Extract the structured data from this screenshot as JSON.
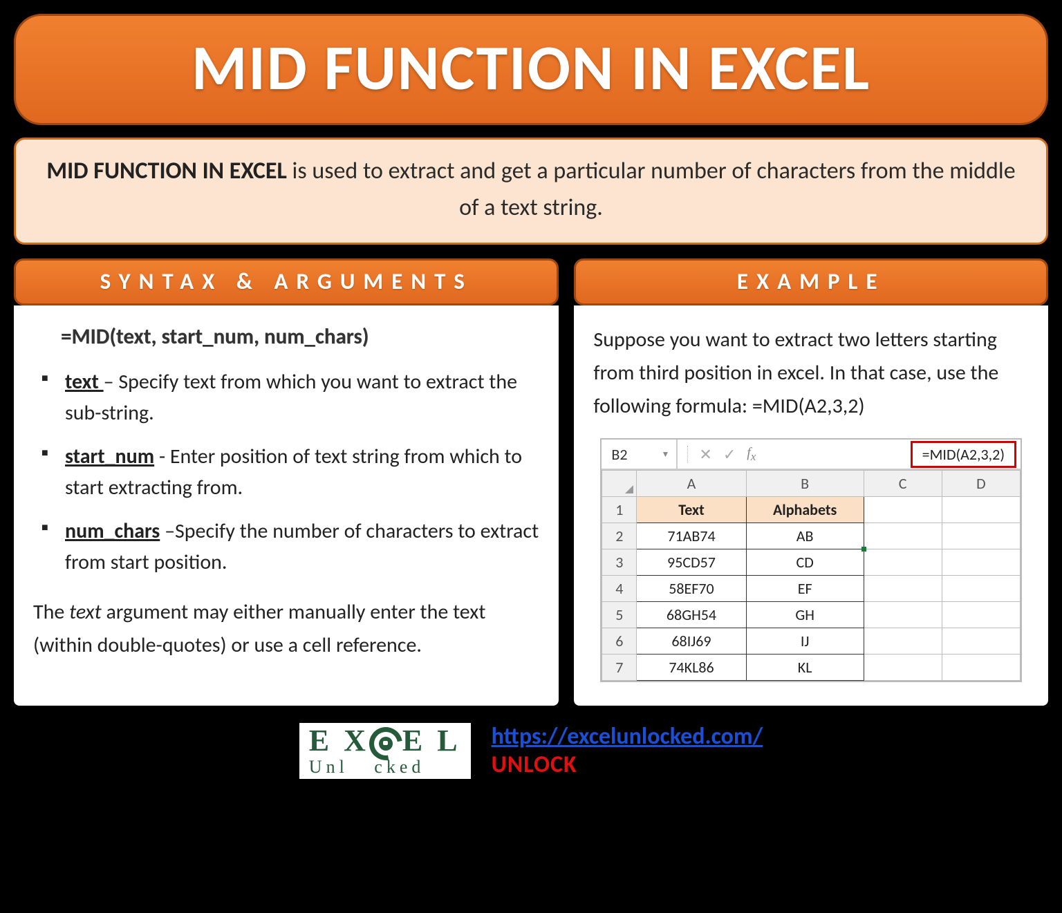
{
  "title": "MID FUNCTION IN EXCEL",
  "intro": {
    "lead": "MID FUNCTION IN EXCEL",
    "rest": " is used to extract and get a particular number of characters from the middle of a text string."
  },
  "left": {
    "header": "SYNTAX & ARGUMENTS",
    "syntax": "=MID(text, start_num, num_chars)",
    "args": [
      {
        "name": "text ",
        "desc": "– Specify text from which you want to extract the sub-string."
      },
      {
        "name": "start_num",
        "desc": " - Enter position of text string from which to start extracting from."
      },
      {
        "name": "num_chars",
        "desc": " –Specify the number of characters to extract from start position."
      }
    ],
    "note_pre": "The ",
    "note_ital": "text",
    "note_post": " argument may either manually enter the text (within double-quotes) or use a cell reference."
  },
  "right": {
    "header": "EXAMPLE",
    "text": "Suppose you want to extract two letters starting from third position in excel. In that case, use the following formula: =MID(A2,3,2)",
    "excel": {
      "nameBox": "B2",
      "formula": "=MID(A2,3,2)",
      "cols": [
        "A",
        "B",
        "C",
        "D"
      ],
      "headerRow": [
        "Text",
        "Alphabets"
      ],
      "rows": [
        [
          "71AB74",
          "AB"
        ],
        [
          "95CD57",
          "CD"
        ],
        [
          "58EF70",
          "EF"
        ],
        [
          "68GH54",
          "GH"
        ],
        [
          "68IJ69",
          "IJ"
        ],
        [
          "74KL86",
          "KL"
        ]
      ]
    }
  },
  "footer": {
    "logoTop": "EX  EL",
    "logoBot": "Unl  cked",
    "url": "https://excelunlocked.com/",
    "unlock": "UNLOCK"
  }
}
